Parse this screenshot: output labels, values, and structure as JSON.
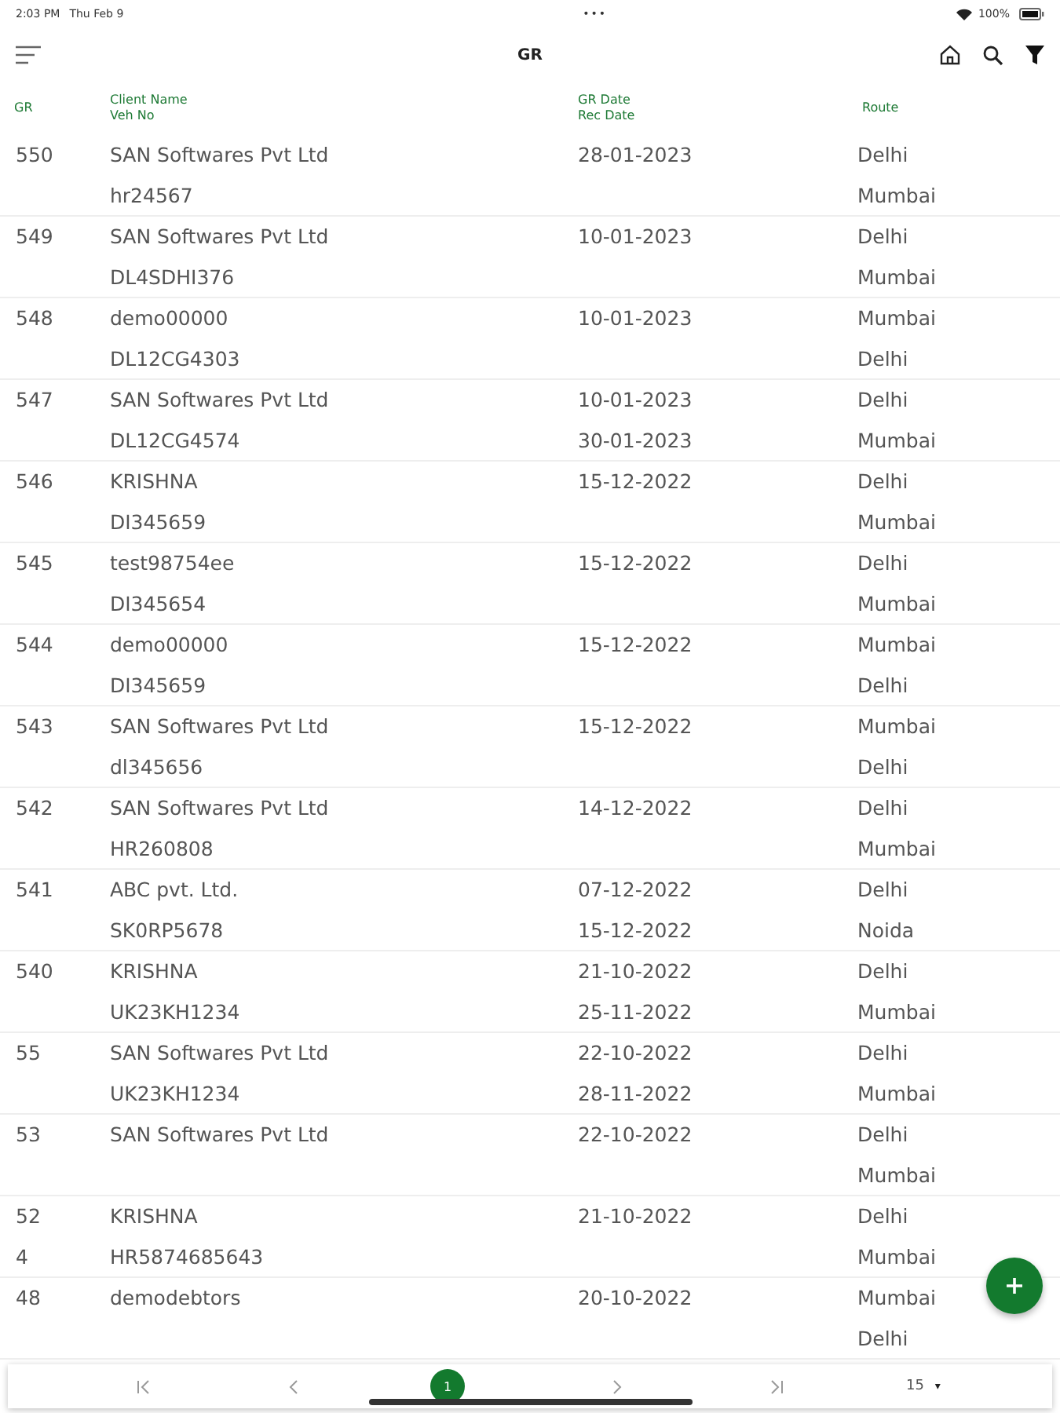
{
  "status_bar": {
    "time": "2:03 PM",
    "date": "Thu Feb 9",
    "dots": "•••",
    "battery_text": "100%"
  },
  "app_bar": {
    "title": "GR"
  },
  "table": {
    "columns": [
      {
        "lines": [
          "GR"
        ]
      },
      {
        "lines": [
          "Client Name",
          "Veh No"
        ]
      },
      {
        "lines": [
          "GR Date",
          "Rec Date"
        ]
      },
      {
        "lines": [
          "Route"
        ]
      }
    ],
    "rows": [
      {
        "gr": [
          "550"
        ],
        "client": "SAN Softwares Pvt Ltd",
        "veh": "hr24567",
        "gr_date": "28-01-2023",
        "from": "Delhi",
        "to": "Mumbai"
      },
      {
        "gr": [
          "549"
        ],
        "client": "SAN Softwares Pvt Ltd",
        "veh": "DL4SDHI376",
        "gr_date": "10-01-2023",
        "from": "Delhi",
        "to": "Mumbai"
      },
      {
        "gr": [
          "548"
        ],
        "client": "demo00000",
        "veh": "DL12CG4303",
        "gr_date": "10-01-2023",
        "from": "Mumbai",
        "to": "Delhi"
      },
      {
        "gr": [
          "547"
        ],
        "client": "SAN Softwares Pvt Ltd",
        "veh": "DL12CG4574",
        "gr_date": "10-01-2023",
        "rec_date": "30-01-2023",
        "from": "Delhi",
        "to": "Mumbai"
      },
      {
        "gr": [
          "546"
        ],
        "client": "KRISHNA",
        "veh": "DI345659",
        "gr_date": "15-12-2022",
        "from": "Delhi",
        "to": "Mumbai"
      },
      {
        "gr": [
          "545"
        ],
        "client": "test98754ee",
        "veh": "DI345654",
        "gr_date": "15-12-2022",
        "from": "Delhi",
        "to": "Mumbai"
      },
      {
        "gr": [
          "544"
        ],
        "client": "demo00000",
        "veh": "DI345659",
        "gr_date": "15-12-2022",
        "from": "Mumbai",
        "to": "Delhi"
      },
      {
        "gr": [
          "543"
        ],
        "client": "SAN Softwares Pvt Ltd",
        "veh": "dl345656",
        "gr_date": "15-12-2022",
        "from": "Mumbai",
        "to": "Delhi"
      },
      {
        "gr": [
          "542"
        ],
        "client": "SAN Softwares Pvt Ltd",
        "veh": "HR260808",
        "gr_date": "14-12-2022",
        "from": "Delhi",
        "to": "Mumbai"
      },
      {
        "gr": [
          "541"
        ],
        "client": "ABC pvt. Ltd.",
        "veh": "SK0RP5678",
        "gr_date": "07-12-2022",
        "rec_date": "15-12-2022",
        "from": "Delhi",
        "to": "Noida"
      },
      {
        "gr": [
          "540"
        ],
        "client": "KRISHNA",
        "veh": "UK23KH1234",
        "gr_date": "21-10-2022",
        "rec_date": "25-11-2022",
        "from": "Delhi",
        "to": "Mumbai"
      },
      {
        "gr": [
          "55"
        ],
        "client": "SAN Softwares Pvt Ltd",
        "veh": "UK23KH1234",
        "gr_date": "22-10-2022",
        "rec_date": "28-11-2022",
        "from": "Delhi",
        "to": "Mumbai"
      },
      {
        "gr": [
          "53"
        ],
        "client": "SAN Softwares Pvt Ltd",
        "gr_date": "22-10-2022",
        "from": "Delhi",
        "to": "Mumbai"
      },
      {
        "gr": [
          "52",
          "4"
        ],
        "client": "KRISHNA",
        "veh": "HR5874685643",
        "gr_date": "21-10-2022",
        "from": "Delhi",
        "to": "Mumbai"
      },
      {
        "gr": [
          "48"
        ],
        "client": "demodebtors",
        "gr_date": "20-10-2022",
        "from": "Mumbai",
        "to": "Delhi"
      }
    ]
  },
  "pagination": {
    "pages": [
      {
        "label": "1",
        "selected": true
      }
    ],
    "page_size": "15",
    "page_size_caret": "▾"
  }
}
